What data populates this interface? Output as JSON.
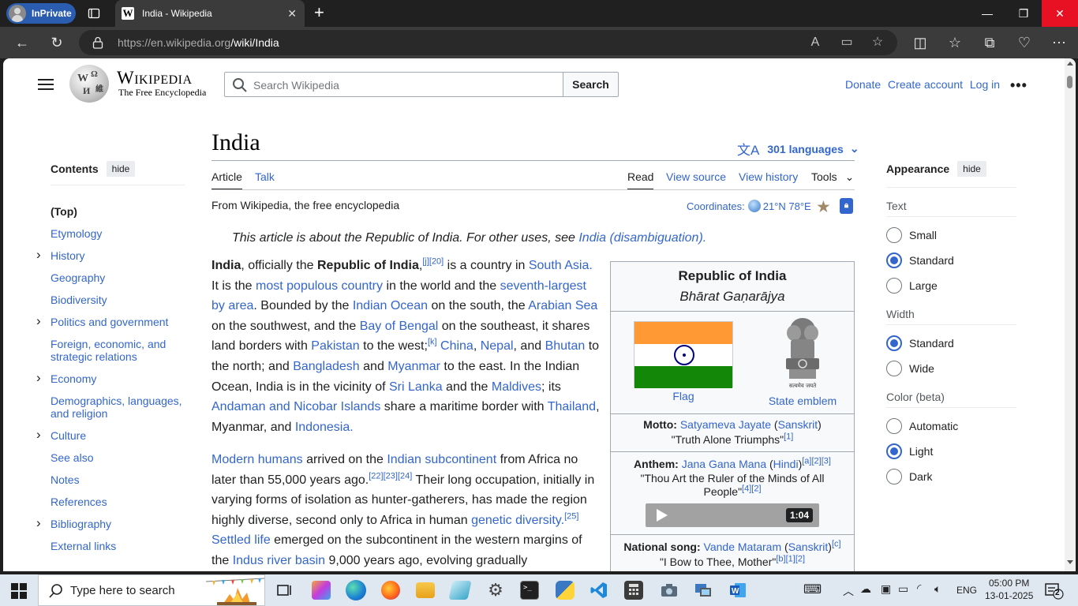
{
  "browser": {
    "inprivate_label": "InPrivate",
    "tab_title": "India - Wikipedia",
    "tab_favicon": "W",
    "url_host": "https://en.wikipedia.org",
    "url_path": "/wiki/India"
  },
  "wiki": {
    "wordmark": "Wikipedia",
    "tagline": "The Free Encyclopedia",
    "search_placeholder": "Search Wikipedia",
    "search_button": "Search",
    "top_links": {
      "donate": "Donate",
      "create_account": "Create account",
      "log_in": "Log in"
    },
    "title": "India",
    "languages": "301 languages",
    "tabs": {
      "article": "Article",
      "talk": "Talk",
      "read": "Read",
      "view_source": "View source",
      "view_history": "View history",
      "tools": "Tools"
    },
    "from": "From Wikipedia, the free encyclopedia",
    "coords_label": "Coordinates:",
    "coords_value": "21°N 78°E",
    "hatnote_text": "This article is about the Republic of India. For other uses, see ",
    "hatnote_link": "India (disambiguation)."
  },
  "contents": {
    "heading": "Contents",
    "hide": "hide",
    "items": [
      {
        "label": "(Top)",
        "expandable": false
      },
      {
        "label": "Etymology",
        "expandable": false
      },
      {
        "label": "History",
        "expandable": true
      },
      {
        "label": "Geography",
        "expandable": false
      },
      {
        "label": "Biodiversity",
        "expandable": false
      },
      {
        "label": "Politics and government",
        "expandable": true
      },
      {
        "label": "Foreign, economic, and strategic relations",
        "expandable": false
      },
      {
        "label": "Economy",
        "expandable": true
      },
      {
        "label": "Demographics, languages, and religion",
        "expandable": false
      },
      {
        "label": "Culture",
        "expandable": true
      },
      {
        "label": "See also",
        "expandable": false
      },
      {
        "label": "Notes",
        "expandable": false
      },
      {
        "label": "References",
        "expandable": false
      },
      {
        "label": "Bibliography",
        "expandable": true
      },
      {
        "label": "External links",
        "expandable": false
      }
    ]
  },
  "appearance": {
    "heading": "Appearance",
    "hide": "hide",
    "text_label": "Text",
    "text_options": [
      "Small",
      "Standard",
      "Large"
    ],
    "text_selected": "Standard",
    "width_label": "Width",
    "width_options": [
      "Standard",
      "Wide"
    ],
    "width_selected": "Standard",
    "color_label": "Color (beta)",
    "color_options": [
      "Automatic",
      "Light",
      "Dark"
    ],
    "color_selected": "Light"
  },
  "infobox": {
    "name": "Republic of India",
    "native_name": "Bhārat Gaṇarājya",
    "flag_caption": "Flag",
    "emblem_caption": "State emblem",
    "emblem_motto_text": "सत्यमेव जयते",
    "motto_label": "Motto:",
    "motto": "Satyameva Jayate",
    "motto_lang": "Sanskrit",
    "motto_translation": "\"Truth Alone Triumphs\"",
    "motto_ref": "[1]",
    "anthem_label": "Anthem:",
    "anthem": "Jana Gana Mana",
    "anthem_lang": "Hindi",
    "anthem_refs": "[a][2][3]",
    "anthem_translation": "\"Thou Art the Ruler of the Minds of All People\"",
    "anthem_translation_refs": "[4][2]",
    "audio_duration": "1:04",
    "song_label": "National song:",
    "song": "Vande Mataram",
    "song_lang": "Sanskrit",
    "song_ref": "[c]",
    "song_translation": "\"I Bow to Thee, Mother\"",
    "song_translation_refs": "[b][1][2]"
  },
  "taskbar": {
    "search_placeholder": "Type here to search",
    "language": "ENG",
    "time": "05:00 PM",
    "date": "13-01-2025",
    "notification_count": "2"
  }
}
